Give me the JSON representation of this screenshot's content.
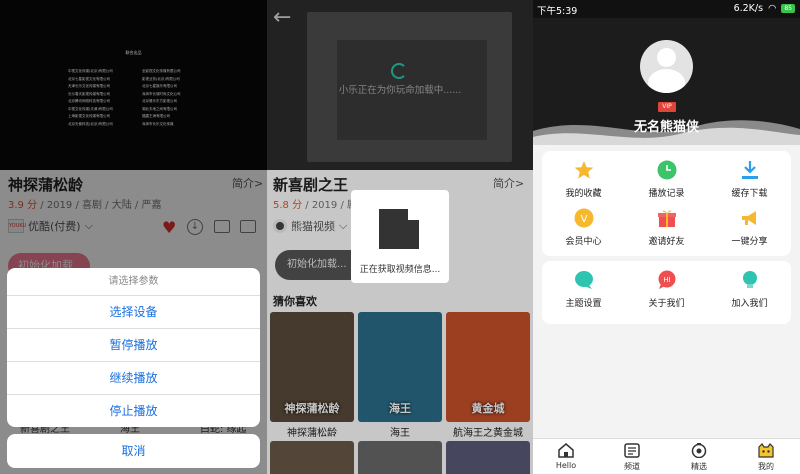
{
  "panel1": {
    "credits_title": "联合出品",
    "credits_left": [
      "中视文化传媒(北京)有限公司",
      "北京七星影视文化有限公司",
      "天津长乐文化传媒有限公司",
      "长沙春天影视传媒有限公司",
      "北京腾讯网络科技有限公司",
      "中视文化传媒(天津)有限公司",
      "上海影视文化传媒有限公司",
      "北京天使科技(北京)有限公司"
    ],
    "credits_right": [
      "全影视文化传媒有限公司",
      "影视业务(北京)有限公司",
      "北京七星娱乐有限公司",
      "深圳市长城时尚文化公司",
      "北京雅乐东方影视公司",
      "湖北天地之间有限公司",
      "福建王海有限公司",
      "深圳市长乐文化传媒"
    ],
    "title": "神探蒲松龄",
    "intro": "简介>",
    "score": "3.9 分",
    "meta_rest": " / 2019 / 喜剧 / 大陆 / 严嘉",
    "source_logo": "YOUKU",
    "source": "优酷(付费)",
    "init_button": "初始化加载",
    "sheet_title": "请选择参数",
    "sheet_items": [
      "选择设备",
      "暂停播放",
      "继续播放",
      "停止播放"
    ],
    "cancel": "取消",
    "peek_texts": [
      "新喜剧之王",
      "海王",
      "白蛇: 缘起"
    ]
  },
  "panel2": {
    "back_icon": "←",
    "loading_text": "小乐正在为你玩命加载中......",
    "title": "新喜剧之王",
    "intro": "简介>",
    "score": "5.8 分",
    "meta_rest": " / 2019 / 剧情",
    "source": "熊猫视频",
    "init_button": "初始化加载...",
    "guess_label": "猜你喜欢",
    "posters": [
      {
        "caption": "神探蒲松龄",
        "overlay": "神探蒲松龄",
        "color": "#5a4a3a"
      },
      {
        "caption": "海王",
        "overlay": "海王",
        "color": "#2a6e8a"
      },
      {
        "caption": "航海王之黄金城",
        "overlay": "黄金城",
        "color": "#c8502a"
      }
    ],
    "popup_text": "正在获取视频信息..."
  },
  "panel3": {
    "time": "下午5:39",
    "net_speed": "6.2K/s",
    "battery": "85",
    "vip_badge": "VIP",
    "username": "无名熊猫侠",
    "grid1": [
      {
        "label": "我的收藏",
        "icon": "star-icon",
        "color": "#f5b82e"
      },
      {
        "label": "播放记录",
        "icon": "clock-icon",
        "color": "#3bc46a"
      },
      {
        "label": "缓存下载",
        "icon": "download-icon",
        "color": "#2d9fe8"
      },
      {
        "label": "会员中心",
        "icon": "vip-coin-icon",
        "color": "#f5b82e"
      },
      {
        "label": "邀请好友",
        "icon": "gift-icon",
        "color": "#ef4f4f"
      },
      {
        "label": "一键分享",
        "icon": "megaphone-icon",
        "color": "#f5b82e"
      }
    ],
    "grid2": [
      {
        "label": "主题设置",
        "icon": "theme-bubble-icon",
        "color": "#2ec4b0"
      },
      {
        "label": "关于我们",
        "icon": "hi-bubble-icon",
        "color": "#ef4f4f"
      },
      {
        "label": "加入我们",
        "icon": "bulb-icon",
        "color": "#2ec4b0"
      }
    ],
    "coin_letter": "V",
    "hi_text": "HI",
    "tabs": [
      "Hello",
      "频道",
      "精选",
      "我的"
    ]
  }
}
